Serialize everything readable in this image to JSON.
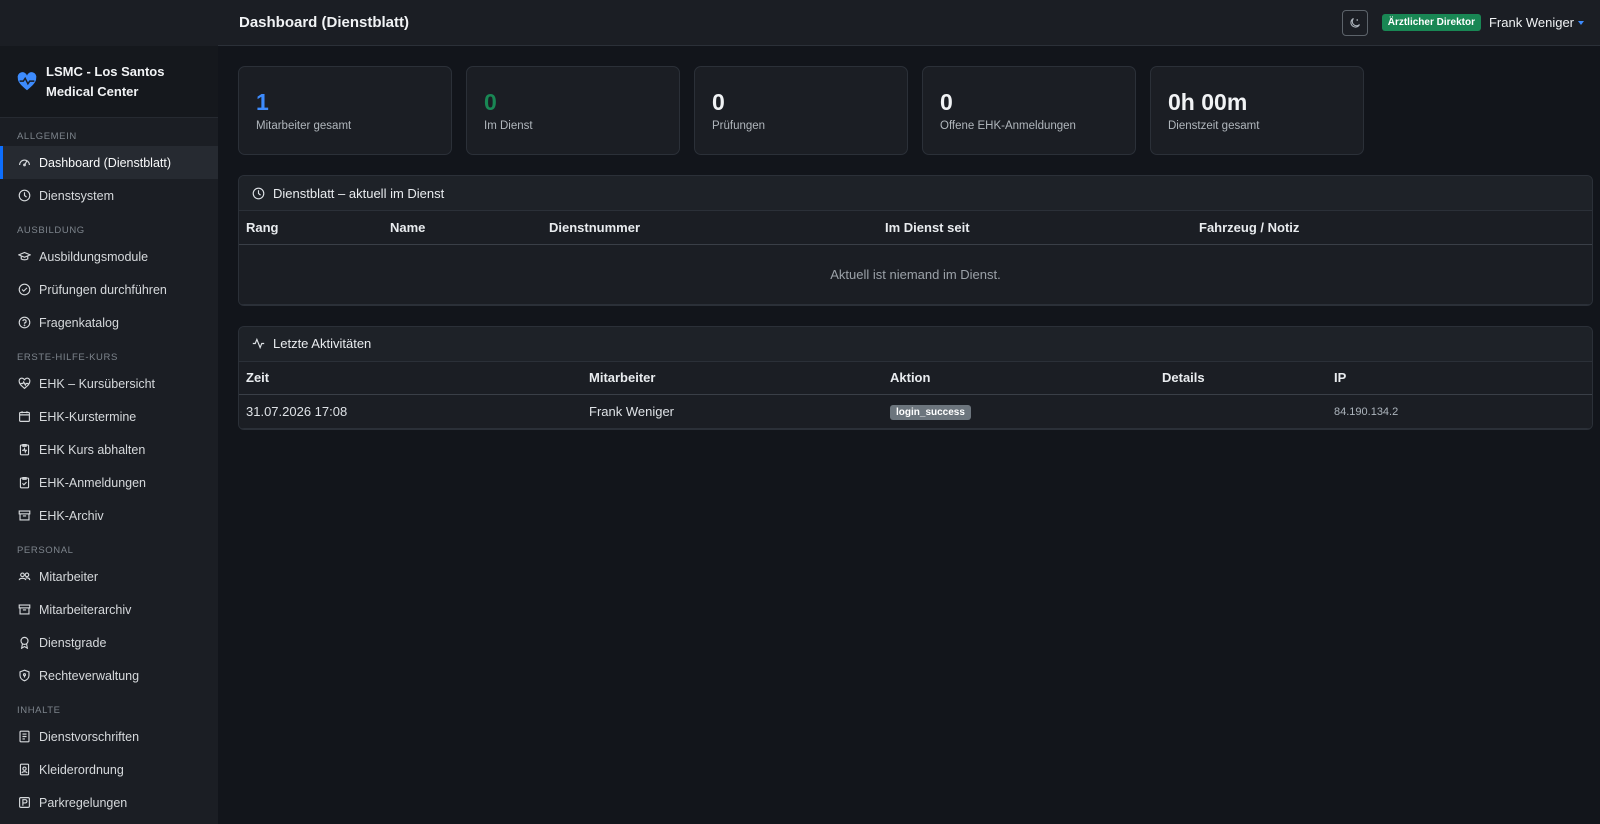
{
  "app": {
    "brand_line1": "LSMC - Los Santos",
    "brand_line2": "Medical Center",
    "accent_color": "#0d6efd"
  },
  "topbar": {
    "title": "Dashboard (Dienstblatt)",
    "theme_toggle_icon": "moon-stars-icon",
    "role_badge": "Ärztlicher Direktor",
    "user_name": "Frank Weniger"
  },
  "sidebar": {
    "sections": {
      "allgemein": "ALLGEMEIN",
      "ausbildung": "AUSBILDUNG",
      "ehk": "ERSTE-HILFE-KURS",
      "personal": "PERSONAL",
      "inhalte": "INHALTE"
    },
    "items": {
      "dashboard": "Dashboard (Dienstblatt)",
      "dienstsystem": "Dienstsystem",
      "ausbildungsmodule": "Ausbildungsmodule",
      "pruefungen": "Prüfungen durchführen",
      "fragenkatalog": "Fragenkatalog",
      "ehk_uebersicht": "EHK – Kursübersicht",
      "ehk_termine": "EHK-Kurstermine",
      "ehk_abhalten": "EHK Kurs abhalten",
      "ehk_anmeldungen": "EHK-Anmeldungen",
      "ehk_archiv": "EHK-Archiv",
      "mitarbeiter": "Mitarbeiter",
      "mitarbeiterarchiv": "Mitarbeiterarchiv",
      "dienstgrade": "Dienstgrade",
      "rechteverwaltung": "Rechteverwaltung",
      "dienstvorschriften": "Dienstvorschriften",
      "kleiderordnung": "Kleiderordnung",
      "parkregelungen": "Parkregelungen"
    }
  },
  "stats": [
    {
      "value": "1",
      "label": "Mitarbeiter gesamt"
    },
    {
      "value": "0",
      "label": "Im Dienst"
    },
    {
      "value": "0",
      "label": "Prüfungen"
    },
    {
      "value": "0",
      "label": "Offene EHK-Anmeldungen"
    },
    {
      "value": "0h 00m",
      "label": "Dienstzeit gesamt"
    }
  ],
  "dienstblatt": {
    "title": "Dienstblatt – aktuell im Dienst",
    "columns": [
      "Rang",
      "Name",
      "Dienstnummer",
      "Im Dienst seit",
      "Fahrzeug / Notiz"
    ],
    "empty_text": "Aktuell ist niemand im Dienst."
  },
  "activities": {
    "title": "Letzte Aktivitäten",
    "columns": [
      "Zeit",
      "Mitarbeiter",
      "Aktion",
      "Details",
      "IP"
    ],
    "rows": [
      {
        "zeit": "31.07.2026 17:08",
        "mitarbeiter": "Frank Weniger",
        "aktion": "login_success",
        "details": "",
        "ip": "84.190.134.2"
      }
    ]
  }
}
